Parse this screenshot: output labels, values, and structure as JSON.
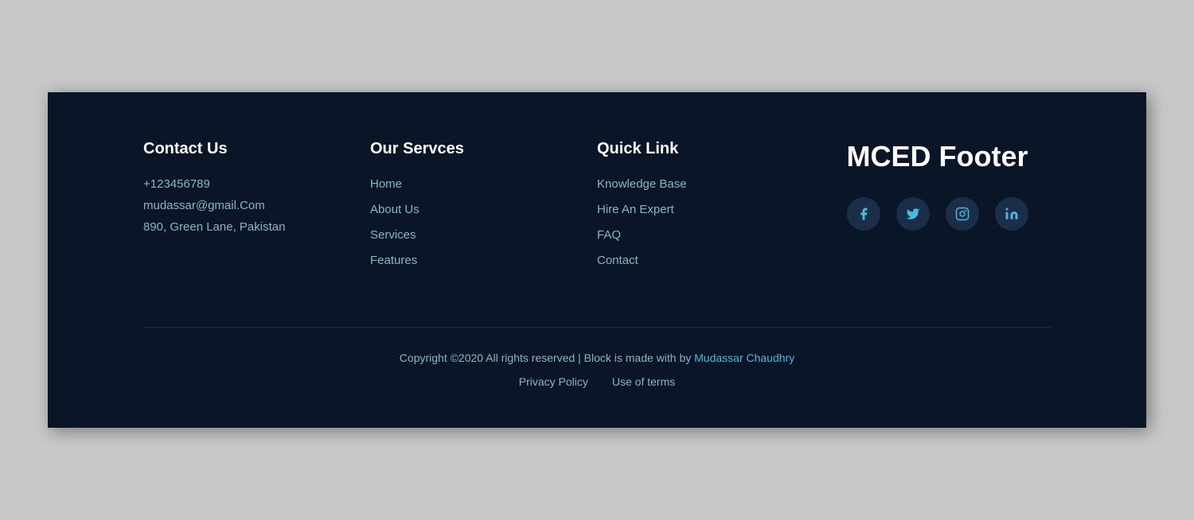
{
  "page": {
    "background": "#c8c8c8",
    "footer_bg": "#0a1628"
  },
  "contact": {
    "heading": "Contact Us",
    "phone": "+123456789",
    "email": "mudassar@gmail.Com",
    "address": "890, Green Lane, Pakistan"
  },
  "services": {
    "heading": "Our Servces",
    "items": [
      {
        "label": "Home",
        "href": "#"
      },
      {
        "label": "About Us",
        "href": "#"
      },
      {
        "label": "Services",
        "href": "#"
      },
      {
        "label": "Features",
        "href": "#"
      }
    ]
  },
  "quicklink": {
    "heading": "Quick Link",
    "items": [
      {
        "label": "Knowledge Base",
        "href": "#"
      },
      {
        "label": "Hire An Expert",
        "href": "#"
      },
      {
        "label": "FAQ",
        "href": "#"
      },
      {
        "label": "Contact",
        "href": "#"
      }
    ]
  },
  "brand": {
    "title": "MCED Footer"
  },
  "social": [
    {
      "name": "facebook",
      "icon": "f",
      "href": "#"
    },
    {
      "name": "twitter",
      "icon": "t",
      "href": "#"
    },
    {
      "name": "instagram",
      "icon": "i",
      "href": "#"
    },
    {
      "name": "linkedin",
      "icon": "in",
      "href": "#"
    }
  ],
  "footer": {
    "copyright": "Copyright ©2020 All rights reserved | Block is made with by",
    "author": "Mudassar Chaudhry",
    "author_href": "#",
    "privacy_policy": "Privacy Policy",
    "use_of_terms": "Use of terms"
  }
}
